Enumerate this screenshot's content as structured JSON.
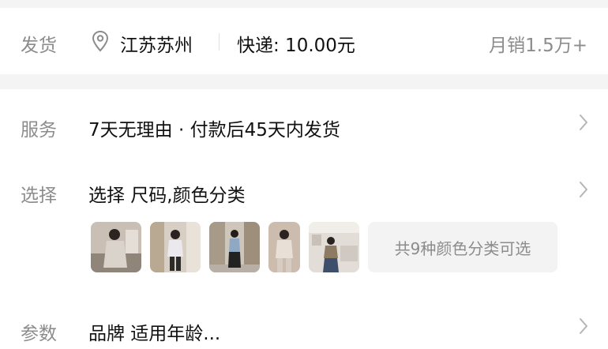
{
  "shipping": {
    "label": "发货",
    "location": "江苏苏州",
    "express": "快递: 10.00元",
    "sales": "月销1.5万+"
  },
  "service": {
    "label": "服务",
    "text": "7天无理由 · 付款后45天内发货"
  },
  "select": {
    "label": "选择",
    "text": "选择 尺码,颜色分类",
    "more": "共9种颜色分类可选"
  },
  "params": {
    "label": "参数",
    "text": "品牌 适用年龄..."
  },
  "icons": {
    "location": "location-pin-icon",
    "chevron": "chevron-right-icon"
  },
  "colors": {
    "label_gray": "#8c8c8c",
    "text": "#111111",
    "background": "#f4f4f4",
    "pill_bg": "#f3f3f3"
  }
}
